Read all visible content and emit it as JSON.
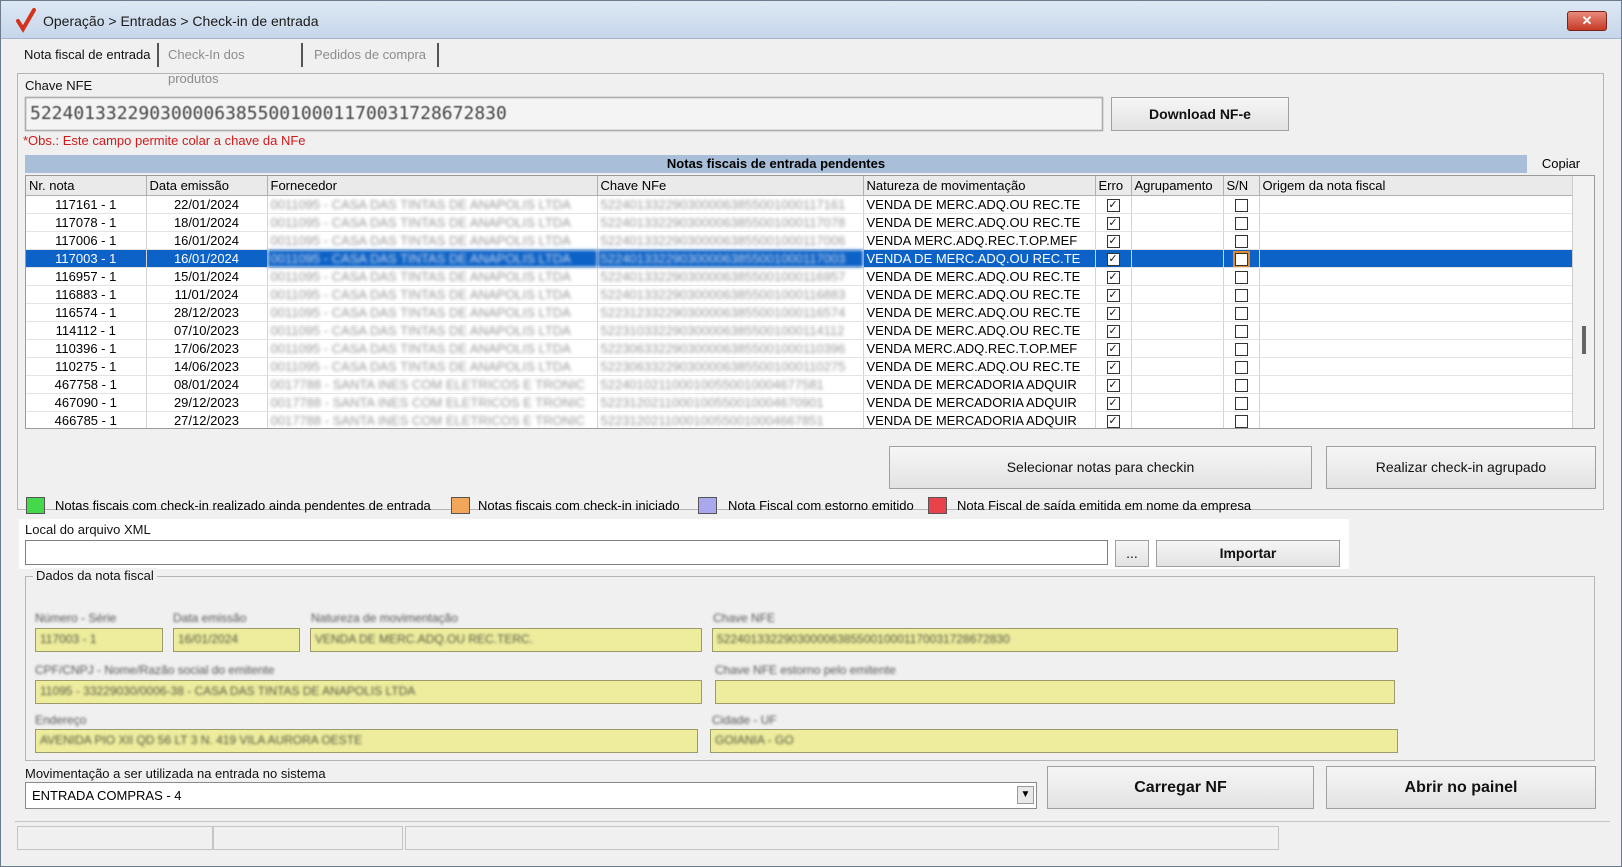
{
  "window": {
    "title": "Operação > Entradas > Check-in de entrada",
    "close_glyph": "✕"
  },
  "tabs": [
    {
      "label": "Nota fiscal de entrada",
      "active": true
    },
    {
      "label": "Check-In dos produtos",
      "active": false
    },
    {
      "label": "Pedidos de compra",
      "active": false
    }
  ],
  "chave_nfe": {
    "label": "Chave NFE",
    "value": "52240133229030000638550010001170031728672830",
    "obs": "*Obs.: Este campo permite colar a chave da NFe",
    "download_button": "Download NF-e"
  },
  "grid": {
    "title": "Notas fiscais de entrada pendentes",
    "copy_button": "Copiar",
    "columns": [
      "Nr. nota",
      "Data emissão",
      "Fornecedor",
      "Chave NFe",
      "Natureza de movimentação",
      "Erro",
      "Agrupamento",
      "S/N",
      "Origem da nota fiscal"
    ],
    "rows": [
      {
        "nr": "117161 - 1",
        "data": "22/01/2024",
        "fornecedor": "0011095 - CASA DAS TINTAS DE ANAPOLIS LTDA",
        "chave": "5224013322903000063855001000117161",
        "natureza": "VENDA DE MERC.ADQ.OU REC.TE",
        "erro": true,
        "sn": false
      },
      {
        "nr": "117078 - 1",
        "data": "18/01/2024",
        "fornecedor": "0011095 - CASA DAS TINTAS DE ANAPOLIS LTDA",
        "chave": "5224013322903000063855001000117078",
        "natureza": "VENDA DE MERC.ADQ.OU REC.TE",
        "erro": true,
        "sn": false
      },
      {
        "nr": "117006 - 1",
        "data": "16/01/2024",
        "fornecedor": "0011095 - CASA DAS TINTAS DE ANAPOLIS LTDA",
        "chave": "5224013322903000063855001000117006",
        "natureza": "VENDA MERC.ADQ.REC.T.OP.MEF",
        "erro": true,
        "sn": false
      },
      {
        "nr": "117003 - 1",
        "data": "16/01/2024",
        "fornecedor": "0011095 - CASA DAS TINTAS DE ANAPOLIS LTDA",
        "chave": "5224013322903000063855001000117003",
        "natureza": "VENDA DE MERC.ADQ.OU REC.TE",
        "erro": true,
        "sn": false,
        "selected": true
      },
      {
        "nr": "116957 - 1",
        "data": "15/01/2024",
        "fornecedor": "0011095 - CASA DAS TINTAS DE ANAPOLIS LTDA",
        "chave": "5224013322903000063855001000116957",
        "natureza": "VENDA DE MERC.ADQ.OU REC.TE",
        "erro": true,
        "sn": false
      },
      {
        "nr": "116883 - 1",
        "data": "11/01/2024",
        "fornecedor": "0011095 - CASA DAS TINTAS DE ANAPOLIS LTDA",
        "chave": "5224013322903000063855001000116883",
        "natureza": "VENDA DE MERC.ADQ.OU REC.TE",
        "erro": true,
        "sn": false
      },
      {
        "nr": "116574 - 1",
        "data": "28/12/2023",
        "fornecedor": "0011095 - CASA DAS TINTAS DE ANAPOLIS LTDA",
        "chave": "5223123322903000063855001000116574",
        "natureza": "VENDA DE MERC.ADQ.OU REC.TE",
        "erro": true,
        "sn": false
      },
      {
        "nr": "114112 - 1",
        "data": "07/10/2023",
        "fornecedor": "0011095 - CASA DAS TINTAS DE ANAPOLIS LTDA",
        "chave": "5223103322903000063855001000114112",
        "natureza": "VENDA DE MERC.ADQ.OU REC.TE",
        "erro": true,
        "sn": false
      },
      {
        "nr": "110396 - 1",
        "data": "17/06/2023",
        "fornecedor": "0011095 - CASA DAS TINTAS DE ANAPOLIS LTDA",
        "chave": "5223063322903000063855001000110396",
        "natureza": "VENDA MERC.ADQ.REC.T.OP.MEF",
        "erro": true,
        "sn": false
      },
      {
        "nr": "110275 - 1",
        "data": "14/06/2023",
        "fornecedor": "0011095 - CASA DAS TINTAS DE ANAPOLIS LTDA",
        "chave": "5223063322903000063855001000110275",
        "natureza": "VENDA DE MERC.ADQ.OU REC.TE",
        "erro": true,
        "sn": false
      },
      {
        "nr": "467758 - 1",
        "data": "08/01/2024",
        "fornecedor": "0017788 - SANTA INES COM ELETRICOS E TRONIC",
        "chave": "5224010211000100550010004677581",
        "natureza": "VENDA DE MERCADORIA ADQUIR",
        "erro": true,
        "sn": false
      },
      {
        "nr": "467090 - 1",
        "data": "29/12/2023",
        "fornecedor": "0017788 - SANTA INES COM ELETRICOS E TRONIC",
        "chave": "5223120211000100550010004670901",
        "natureza": "VENDA DE MERCADORIA ADQUIR",
        "erro": true,
        "sn": false
      },
      {
        "nr": "466785 - 1",
        "data": "27/12/2023",
        "fornecedor": "0017788 - SANTA INES COM ELETRICOS E TRONIC",
        "chave": "5223120211000100550010004667851",
        "natureza": "VENDA DE MERCADORIA ADQUIR",
        "erro": true,
        "sn": false
      }
    ]
  },
  "actions": {
    "select_notes": "Selecionar notas para checkin",
    "grouped_checkin": "Realizar check-in agrupado"
  },
  "legend": [
    {
      "color": "#44d94a",
      "label": "Notas fiscais com check-in realizado ainda pendentes de entrada"
    },
    {
      "color": "#f2a65a",
      "label": "Notas fiscais com check-in iniciado"
    },
    {
      "color": "#a9a8ec",
      "label": "Nota Fiscal com estorno emitido"
    },
    {
      "color": "#e8434b",
      "label": "Nota Fiscal de saída emitida em nome da empresa"
    }
  ],
  "xml": {
    "label": "Local do arquivo XML",
    "value": "",
    "browse_button": "...",
    "import_button": "Importar"
  },
  "dados": {
    "title": "Dados da nota fiscal",
    "numero_label": "Número - Série",
    "numero_value": "117003 - 1",
    "data_label": "Data emissão",
    "data_value": "16/01/2024",
    "natureza_label": "Natureza de movimentação",
    "natureza_value": "VENDA DE MERC.ADQ.OU REC.TERC.",
    "chave_label": "Chave NFE",
    "chave_value": "52240133229030000638550010001170031728672830",
    "cpf_label": "CPF/CNPJ - Nome/Razão social do emitente",
    "cpf_value": "11095 - 33229030/0006-38 - CASA DAS TINTAS DE ANAPOLIS LTDA",
    "estorno_label": "Chave NFE estorno pelo emitente",
    "estorno_value": "",
    "endereco_label": "Endereço",
    "endereco_value": "AVENIDA PIO XII QD 56 LT 3 N. 419 VILA AURORA OESTE",
    "cidade_label": "Cidade - UF",
    "cidade_value": "GOIANIA - GO"
  },
  "movimentacao": {
    "label": "Movimentação a ser utilizada na entrada no sistema",
    "selected": "ENTRADA COMPRAS - 4",
    "arrow": "▼"
  },
  "bottom_buttons": {
    "carregar": "Carregar NF",
    "abrir": "Abrir no painel"
  },
  "check_glyph": "✓"
}
